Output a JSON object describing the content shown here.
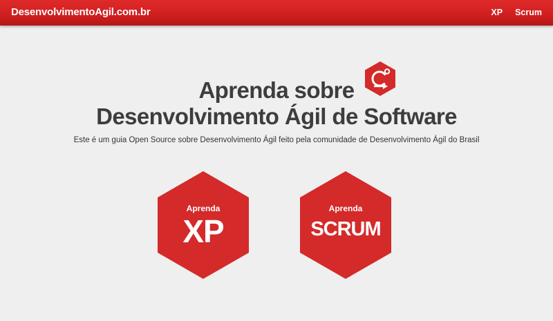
{
  "navbar": {
    "brand": "DesenvolvimentoAgil.com.br",
    "links": [
      {
        "label": "XP"
      },
      {
        "label": "Scrum"
      }
    ]
  },
  "hero": {
    "title_line1": "Aprenda sobre",
    "title_line2": "Desenvolvimento Ágil de Software",
    "subtitle": "Este é um guia Open Source sobre Desenvolvimento Ágil feito pela comunidade de Desenvolvimento Ágil do Brasil",
    "logo_icon": "agile-cycle-hexagon-icon"
  },
  "cards": [
    {
      "small": "Aprenda",
      "big": "XP"
    },
    {
      "small": "Aprenda",
      "big": "SCRUM"
    }
  ],
  "colors": {
    "brand_red": "#d42a2a",
    "navbar_red": "#cf1f1f",
    "background": "#efefef",
    "text": "#3d3d3d"
  }
}
